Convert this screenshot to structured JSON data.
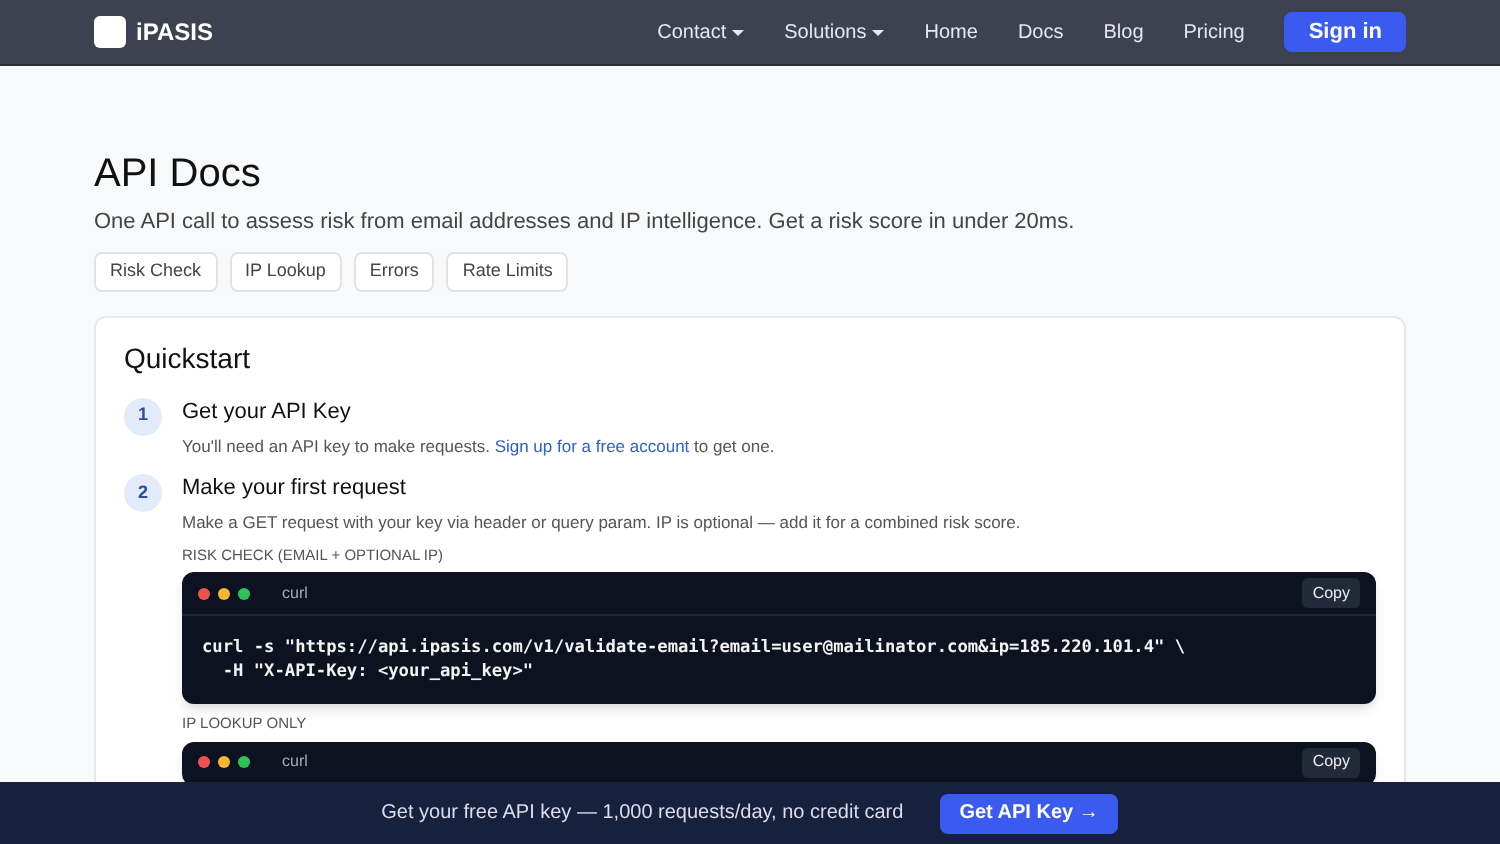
{
  "nav": {
    "brand": "iPASIS",
    "links": [
      {
        "label": "Contact",
        "dropdown": true
      },
      {
        "label": "Solutions",
        "dropdown": true
      },
      {
        "label": "Home",
        "dropdown": false
      },
      {
        "label": "Docs",
        "dropdown": false
      },
      {
        "label": "Blog",
        "dropdown": false
      },
      {
        "label": "Pricing",
        "dropdown": false
      }
    ],
    "signin": "Sign in"
  },
  "page": {
    "title": "API Docs",
    "subtitle": "One API call to assess risk from email addresses and IP intelligence. Get a risk score in under 20ms.",
    "chips": [
      "Risk Check",
      "IP Lookup",
      "Errors",
      "Rate Limits"
    ]
  },
  "quickstart": {
    "title": "Quickstart",
    "steps": [
      {
        "number": "1",
        "title": "Get your API Key",
        "text_before": "You'll need an API key to make requests.",
        "link": "Sign up for a free account",
        "text_after": "to get one."
      },
      {
        "number": "2",
        "title": "Make your first request",
        "text_before": "Make a GET request with your key via header or query param. IP is optional — add it for a combined risk score."
      }
    ],
    "code_blocks": [
      {
        "label": "RISK CHECK (EMAIL + OPTIONAL IP)",
        "lang": "curl",
        "copy": "Copy",
        "lines": [
          "curl -s \"https://api.ipasis.com/v1/validate-email?email=user@mailinator.com&ip=185.220.101.4\" \\",
          "  -H \"X-API-Key: <your_api_key>\""
        ]
      },
      {
        "label": "IP LOOKUP ONLY",
        "lang": "curl",
        "copy": "Copy"
      }
    ]
  },
  "banner": {
    "text": "Get your free API key — 1,000 requests/day, no credit card",
    "button": "Get API Key →"
  }
}
